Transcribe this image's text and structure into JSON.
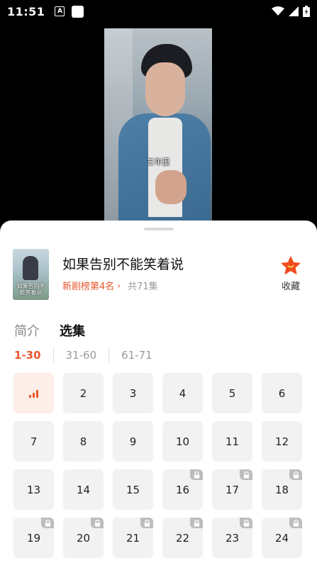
{
  "status_bar": {
    "time": "11:51",
    "notif_letter": "A"
  },
  "video": {
    "caption": "三年里"
  },
  "drama": {
    "poster_text": "如果告别不能笑着说",
    "title": "如果告别不能笑着说",
    "rank": "新剧榜第4名",
    "episode_count": "共71集",
    "favorite_label": "收藏"
  },
  "tabs": [
    {
      "label": "简介",
      "active": false
    },
    {
      "label": "选集",
      "active": true
    }
  ],
  "ranges": [
    {
      "label": "1-30",
      "active": true
    },
    {
      "label": "31-60",
      "active": false
    },
    {
      "label": "61-71",
      "active": false
    }
  ],
  "episodes": [
    {
      "num": "1",
      "current": true,
      "locked": false
    },
    {
      "num": "2",
      "current": false,
      "locked": false
    },
    {
      "num": "3",
      "current": false,
      "locked": false
    },
    {
      "num": "4",
      "current": false,
      "locked": false
    },
    {
      "num": "5",
      "current": false,
      "locked": false
    },
    {
      "num": "6",
      "current": false,
      "locked": false
    },
    {
      "num": "7",
      "current": false,
      "locked": false
    },
    {
      "num": "8",
      "current": false,
      "locked": false
    },
    {
      "num": "9",
      "current": false,
      "locked": false
    },
    {
      "num": "10",
      "current": false,
      "locked": false
    },
    {
      "num": "11",
      "current": false,
      "locked": false
    },
    {
      "num": "12",
      "current": false,
      "locked": false
    },
    {
      "num": "13",
      "current": false,
      "locked": false
    },
    {
      "num": "14",
      "current": false,
      "locked": false
    },
    {
      "num": "15",
      "current": false,
      "locked": false
    },
    {
      "num": "16",
      "current": false,
      "locked": true
    },
    {
      "num": "17",
      "current": false,
      "locked": true
    },
    {
      "num": "18",
      "current": false,
      "locked": true
    },
    {
      "num": "19",
      "current": false,
      "locked": true
    },
    {
      "num": "20",
      "current": false,
      "locked": true
    },
    {
      "num": "21",
      "current": false,
      "locked": true
    },
    {
      "num": "22",
      "current": false,
      "locked": true
    },
    {
      "num": "23",
      "current": false,
      "locked": true
    },
    {
      "num": "24",
      "current": false,
      "locked": true
    }
  ],
  "colors": {
    "accent": "#e8572b",
    "current_bg": "#fdeee7",
    "tile_bg": "#f2f2f2",
    "star": "#f24b1f"
  },
  "icons": {
    "favorite": "star-icon",
    "lock": "lock-icon",
    "playing": "playing-bars-icon"
  }
}
